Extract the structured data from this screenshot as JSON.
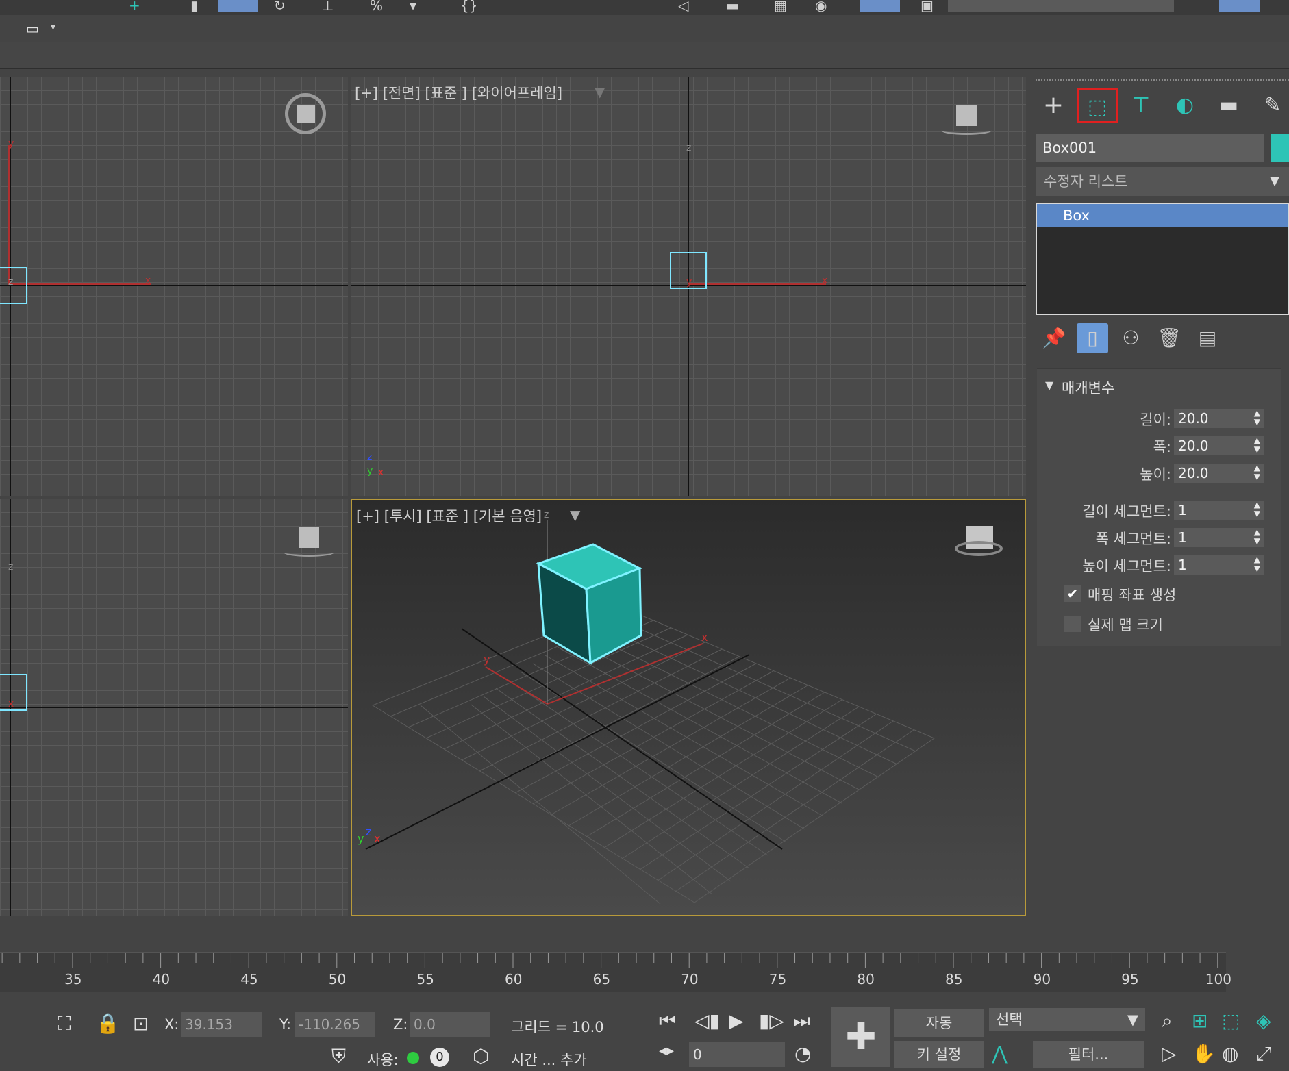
{
  "viewports": {
    "front_label": "[+] [전면] [표준 ] [와이어프레임]",
    "perspective_label": "[+] [투시] [표준 ] [기본 음영]",
    "axis_x": "x",
    "axis_y": "y",
    "axis_z": "z"
  },
  "command_panel": {
    "object_name": "Box001",
    "object_color": "#2ec4b6",
    "modifier_list_label": "수정자 리스트",
    "stack_item": "Box",
    "parameters_title": "매개변수",
    "length_label": "길이:",
    "length_value": "20.0",
    "width_label": "폭:",
    "width_value": "20.0",
    "height_label": "높이:",
    "height_value": "20.0",
    "length_segs_label": "길이 세그먼트:",
    "length_segs_value": "1",
    "width_segs_label": "폭 세그먼트:",
    "width_segs_value": "1",
    "height_segs_label": "높이 세그먼트:",
    "height_segs_value": "1",
    "gen_mapping_label": "매핑 좌표 생성",
    "gen_mapping_checked": true,
    "real_world_label": "실제 맵 크기",
    "real_world_checked": false
  },
  "timeline": {
    "ticks": [
      "35",
      "40",
      "45",
      "50",
      "55",
      "60",
      "65",
      "70",
      "75",
      "80",
      "85",
      "90",
      "95",
      "100"
    ]
  },
  "status": {
    "x_label": "X:",
    "x_value": "39.153",
    "y_label": "Y:",
    "y_value": "-110.265",
    "z_label": "Z:",
    "z_value": "0.0",
    "grid_label": "그리드 = 10.0",
    "frame_value": "0",
    "auto_key": "자동",
    "set_key": "키 설정",
    "selection_dropdown": "선택",
    "filters_button": "필터...",
    "enabled_label": "사용:",
    "enabled_count": "0",
    "add_time_tag": "시간 ... 추가"
  }
}
